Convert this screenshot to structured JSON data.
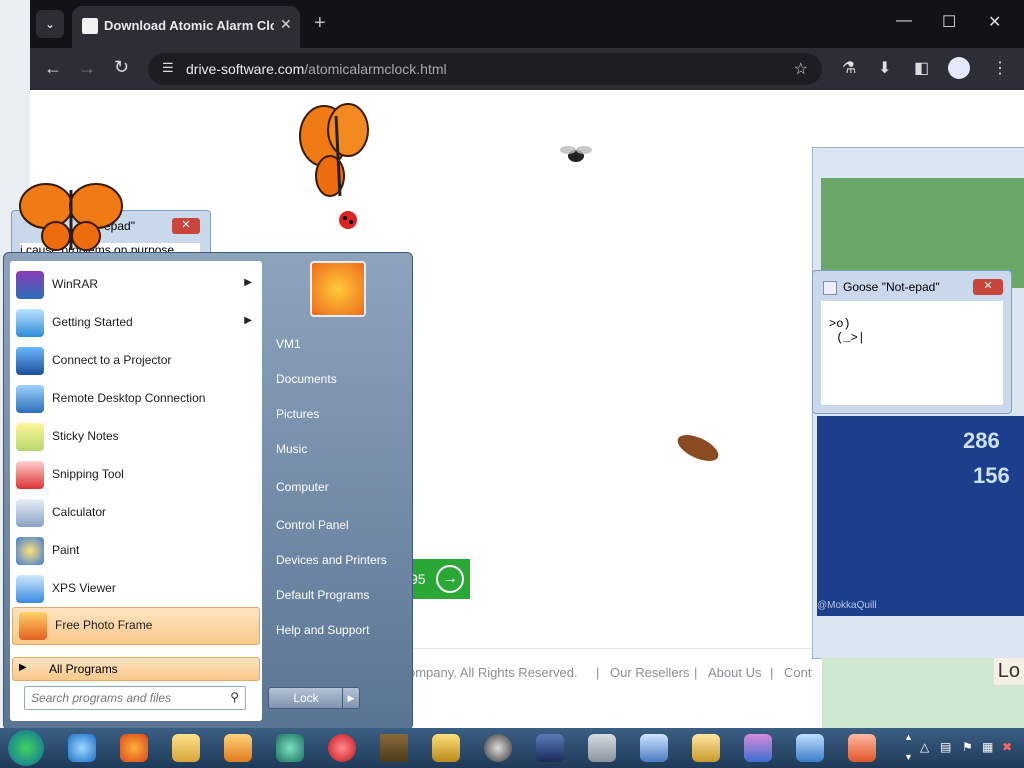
{
  "browser": {
    "tab_title": "Download Atomic Alarm Clock",
    "url_domain": "drive-software.com",
    "url_path": "/atomicalarmclock.html"
  },
  "icons": {
    "tab_dropdown": "chevron-down-icon",
    "close": "close-icon",
    "new_tab": "plus-icon",
    "back": "back-arrow-icon",
    "forward": "forward-arrow-icon",
    "reload": "reload-icon",
    "site_info": "tune-icon",
    "bookmark": "star-icon",
    "labs": "flask-icon",
    "download": "download-icon",
    "side_panel": "side-panel-icon",
    "profile": "profile-icon",
    "menu": "more-vert-icon"
  },
  "page": {
    "price_fragment": "95",
    "footer": {
      "copyright": "ompany. All Rights Reserved.",
      "links": [
        "Our Resellers",
        "About Us",
        "Cont"
      ],
      "separator": "|"
    }
  },
  "notepad_small": {
    "title": "epad\"",
    "text": "i cause problems on purpose"
  },
  "goose_window": {
    "title": "Goose \"Not-epad\"",
    "body": ">o)\n (_>|"
  },
  "meme": {
    "numbers": [
      "286",
      "156"
    ],
    "credit": "@MokkaQuill"
  },
  "right_strip_text": "Lo",
  "start_menu": {
    "programs": [
      {
        "label": "WinRAR",
        "has_submenu": true
      },
      {
        "label": "Getting Started",
        "has_submenu": true
      },
      {
        "label": "Connect to a Projector",
        "has_submenu": false
      },
      {
        "label": "Remote Desktop Connection",
        "has_submenu": false
      },
      {
        "label": "Sticky Notes",
        "has_submenu": false
      },
      {
        "label": "Snipping Tool",
        "has_submenu": false
      },
      {
        "label": "Calculator",
        "has_submenu": false
      },
      {
        "label": "Paint",
        "has_submenu": false
      },
      {
        "label": "XPS Viewer",
        "has_submenu": false
      },
      {
        "label": "Free Photo Frame",
        "has_submenu": false
      }
    ],
    "all_programs": "All Programs",
    "search_placeholder": "Search programs and files",
    "right_items": [
      "VM1",
      "Documents",
      "Pictures",
      "Music",
      "Computer",
      "Control Panel",
      "Devices and Printers",
      "Default Programs",
      "Help and Support"
    ],
    "lock_label": "Lock"
  },
  "taskbar": {
    "apps": [
      "Internet Explorer",
      "Firefox",
      "Explorer",
      "Media Player",
      "App",
      "Opera",
      "Minecraft",
      "Tools",
      "Speed",
      "Display",
      "Chain",
      "Network",
      "Cleaner",
      "Archive",
      "Users",
      "Eraser"
    ]
  },
  "colors": {
    "green_button": "#2aa836",
    "tab_bg": "#2b2f35",
    "taskbar": "#1f3a58"
  }
}
